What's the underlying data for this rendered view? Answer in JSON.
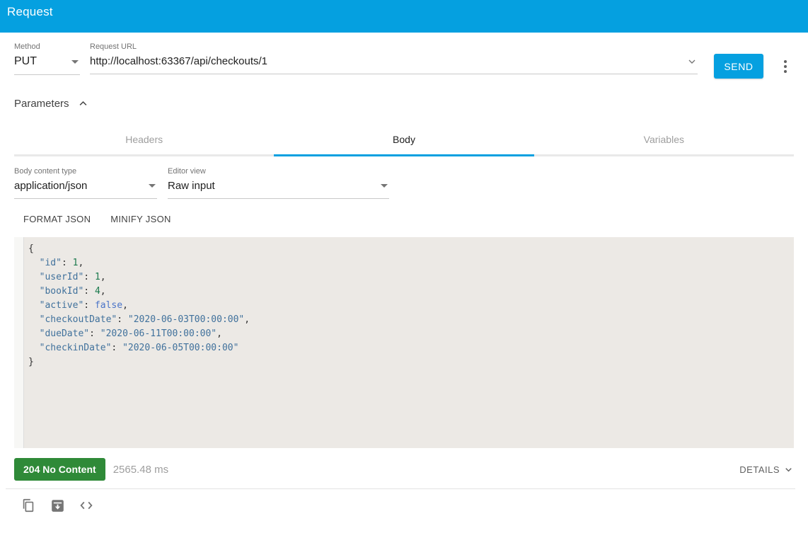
{
  "header": {
    "title": "Request"
  },
  "request_bar": {
    "method_label": "Method",
    "method_value": "PUT",
    "url_label": "Request URL",
    "url_value": "http://localhost:63367/api/checkouts/1",
    "send_label": "SEND"
  },
  "parameters": {
    "label": "Parameters"
  },
  "tabs": [
    {
      "label": "Headers",
      "active": false
    },
    {
      "label": "Body",
      "active": true
    },
    {
      "label": "Variables",
      "active": false
    }
  ],
  "body_editor": {
    "content_type_label": "Body content type",
    "content_type_value": "application/json",
    "editor_view_label": "Editor view",
    "editor_view_value": "Raw input",
    "format_button": "FORMAT JSON",
    "minify_button": "MINIFY JSON",
    "code_lines": [
      [
        {
          "t": "p",
          "v": "{"
        }
      ],
      [
        {
          "t": "p",
          "v": "  "
        },
        {
          "t": "s",
          "v": "\"id\""
        },
        {
          "t": "p",
          "v": ": "
        },
        {
          "t": "n",
          "v": "1"
        },
        {
          "t": "p",
          "v": ","
        }
      ],
      [
        {
          "t": "p",
          "v": "  "
        },
        {
          "t": "s",
          "v": "\"userId\""
        },
        {
          "t": "p",
          "v": ": "
        },
        {
          "t": "n",
          "v": "1"
        },
        {
          "t": "p",
          "v": ","
        }
      ],
      [
        {
          "t": "p",
          "v": "  "
        },
        {
          "t": "s",
          "v": "\"bookId\""
        },
        {
          "t": "p",
          "v": ": "
        },
        {
          "t": "n",
          "v": "4"
        },
        {
          "t": "p",
          "v": ","
        }
      ],
      [
        {
          "t": "p",
          "v": "  "
        },
        {
          "t": "s",
          "v": "\"active\""
        },
        {
          "t": "p",
          "v": ": "
        },
        {
          "t": "a",
          "v": "false"
        },
        {
          "t": "p",
          "v": ","
        }
      ],
      [
        {
          "t": "p",
          "v": "  "
        },
        {
          "t": "s",
          "v": "\"checkoutDate\""
        },
        {
          "t": "p",
          "v": ": "
        },
        {
          "t": "s",
          "v": "\"2020-06-03T00:00:00\""
        },
        {
          "t": "p",
          "v": ","
        }
      ],
      [
        {
          "t": "p",
          "v": "  "
        },
        {
          "t": "s",
          "v": "\"dueDate\""
        },
        {
          "t": "p",
          "v": ": "
        },
        {
          "t": "s",
          "v": "\"2020-06-11T00:00:00\""
        },
        {
          "t": "p",
          "v": ","
        }
      ],
      [
        {
          "t": "p",
          "v": "  "
        },
        {
          "t": "s",
          "v": "\"checkinDate\""
        },
        {
          "t": "p",
          "v": ": "
        },
        {
          "t": "s",
          "v": "\"2020-06-05T00:00:00\""
        }
      ],
      [
        {
          "t": "p",
          "v": "}"
        }
      ]
    ]
  },
  "response_status": {
    "status_code": "204 No Content",
    "time": "2565.48 ms",
    "details_label": "DETAILS"
  },
  "colors": {
    "accent_blue": "#05a0e0",
    "status_green": "#2f8a38",
    "editor_background": "#ece9e5",
    "syntax_key_string": "#40719c",
    "syntax_number": "#1c7a4d",
    "syntax_atom": "#4a74c8",
    "icon_gray": "#757575"
  }
}
